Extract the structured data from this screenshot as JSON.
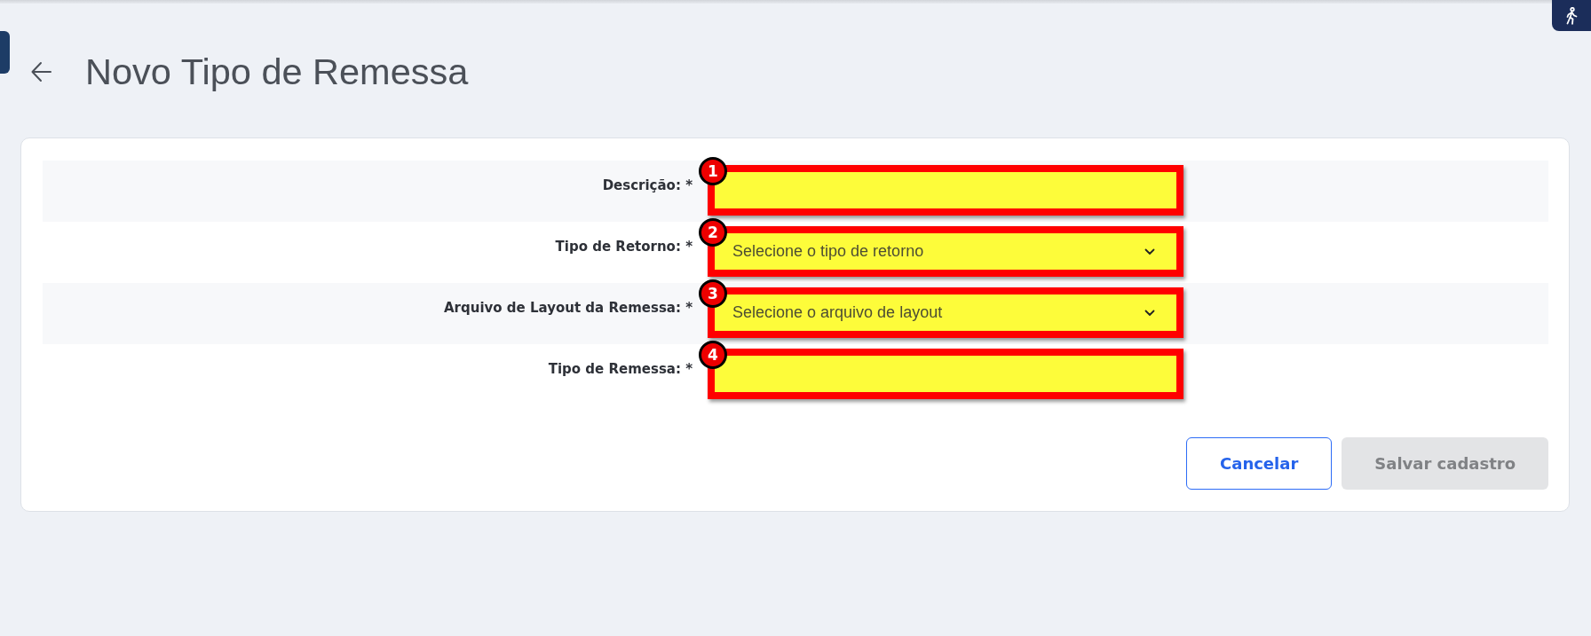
{
  "page": {
    "title": "Novo Tipo de Remessa"
  },
  "form": {
    "fields": [
      {
        "label": "Descrição: *",
        "kind": "text",
        "marker": "1",
        "highlighted": true
      },
      {
        "label": "Tipo de Retorno: *",
        "kind": "select",
        "placeholder": "Selecione o tipo de retorno",
        "marker": "2",
        "highlighted": true
      },
      {
        "label": "Arquivo de Layout da Remessa: *",
        "kind": "select",
        "placeholder": "Selecione o arquivo de layout",
        "marker": "3",
        "highlighted": true
      },
      {
        "label": "Tipo de Remessa: *",
        "kind": "text",
        "marker": "4",
        "highlighted": true
      }
    ],
    "buttons": [
      {
        "label": "Cancelar",
        "kind": "outline",
        "disabled": false
      },
      {
        "label": "Salvar cadastro",
        "kind": "filled",
        "disabled": true
      }
    ]
  }
}
